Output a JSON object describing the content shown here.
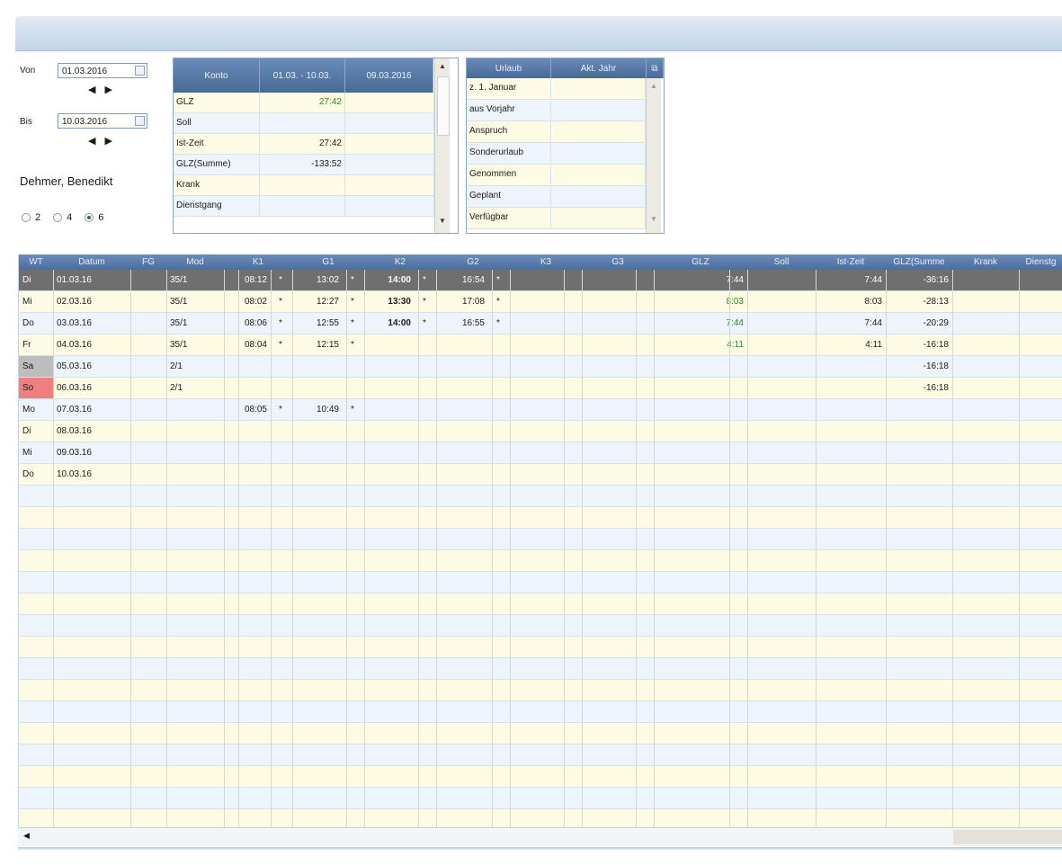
{
  "filter": {
    "von_label": "Von",
    "von_date": "01.03.2016",
    "bis_label": "Bis",
    "bis_date": "10.03.2016",
    "employee": "Dehmer, Benedikt",
    "radio_options": [
      "2",
      "4",
      "6"
    ],
    "radio_selected": "6"
  },
  "konto": {
    "headers": [
      "Konto",
      "01.03. - 10.03.",
      "09.03.2016"
    ],
    "rows": [
      {
        "label": "GLZ",
        "v1": "27:42",
        "v2": ""
      },
      {
        "label": "Soll",
        "v1": "",
        "v2": ""
      },
      {
        "label": "Ist-Zeit",
        "v1": "27:42",
        "v2": ""
      },
      {
        "label": "GLZ(Summe)",
        "v1": "-133:52",
        "v2": ""
      },
      {
        "label": "Krank",
        "v1": "",
        "v2": ""
      },
      {
        "label": "Dienstgang",
        "v1": "",
        "v2": ""
      }
    ]
  },
  "urlaub": {
    "headers": [
      "Urlaub",
      "Akt. Jahr"
    ],
    "rows": [
      "z. 1. Januar",
      "aus Vorjahr",
      "Anspruch",
      "Sonderurlaub",
      "Genommen",
      "Geplant",
      "Verfügbar"
    ]
  },
  "grid": {
    "columns": [
      "WT",
      "Datum",
      "FG",
      "Mod",
      "K1",
      "G1",
      "K2",
      "G2",
      "K3",
      "G3",
      "GLZ",
      "Soll",
      "Ist-Zeit",
      "GLZ(Summe",
      "Krank",
      "Dienstg"
    ],
    "rows": [
      {
        "wt": "Di",
        "datum": "01.03.16",
        "mod": "35/1",
        "k1": "08:12",
        "g1": "13:02",
        "k2": "14:00",
        "g2": "16:54",
        "glz": "7:44",
        "ist": "7:44",
        "sum": "-36:16",
        "selected": true
      },
      {
        "wt": "Mi",
        "datum": "02.03.16",
        "mod": "35/1",
        "k1": "08:02",
        "g1": "12:27",
        "k2": "13:30",
        "g2": "17:08",
        "glz": "8:03",
        "ist": "8:03",
        "sum": "-28:13"
      },
      {
        "wt": "Do",
        "datum": "03.03.16",
        "mod": "35/1",
        "k1": "08:06",
        "g1": "12:55",
        "k2": "14:00",
        "g2": "16:55",
        "glz": "7:44",
        "ist": "7:44",
        "sum": "-20:29"
      },
      {
        "wt": "Fr",
        "datum": "04.03.16",
        "mod": "35/1",
        "k1": "08:04",
        "g1": "12:15",
        "k2": "",
        "g2": "",
        "glz": "4:11",
        "ist": "4:11",
        "sum": "-16:18"
      },
      {
        "wt": "Sa",
        "datum": "05.03.16",
        "mod": "2/1",
        "k1": "",
        "g1": "",
        "k2": "",
        "g2": "",
        "glz": "",
        "ist": "",
        "sum": "-16:18",
        "day": "sa"
      },
      {
        "wt": "So",
        "datum": "06.03.16",
        "mod": "2/1",
        "k1": "",
        "g1": "",
        "k2": "",
        "g2": "",
        "glz": "",
        "ist": "",
        "sum": "-16:18",
        "day": "so"
      },
      {
        "wt": "Mo",
        "datum": "07.03.16",
        "mod": "",
        "k1": "08:05",
        "g1": "10:49",
        "k2": "",
        "g2": "",
        "glz": "",
        "ist": "",
        "sum": ""
      },
      {
        "wt": "Di",
        "datum": "08.03.16",
        "mod": "",
        "k1": "",
        "g1": "",
        "k2": "",
        "g2": "",
        "glz": "",
        "ist": "",
        "sum": ""
      },
      {
        "wt": "Mi",
        "datum": "09.03.16",
        "mod": "",
        "k1": "",
        "g1": "",
        "k2": "",
        "g2": "",
        "glz": "",
        "ist": "",
        "sum": ""
      },
      {
        "wt": "Do",
        "datum": "10.03.16",
        "mod": "",
        "k1": "",
        "g1": "",
        "k2": "",
        "g2": "",
        "glz": "",
        "ist": "",
        "sum": ""
      }
    ],
    "marker": "*"
  },
  "colors": {
    "glz_green": "#2a8a2a",
    "row_yellow": "#fdfbe3",
    "row_blue": "#eef4fb",
    "selected_row": "#6f6f6f",
    "saturday": "#bdbdbd",
    "sunday": "#f08080"
  }
}
